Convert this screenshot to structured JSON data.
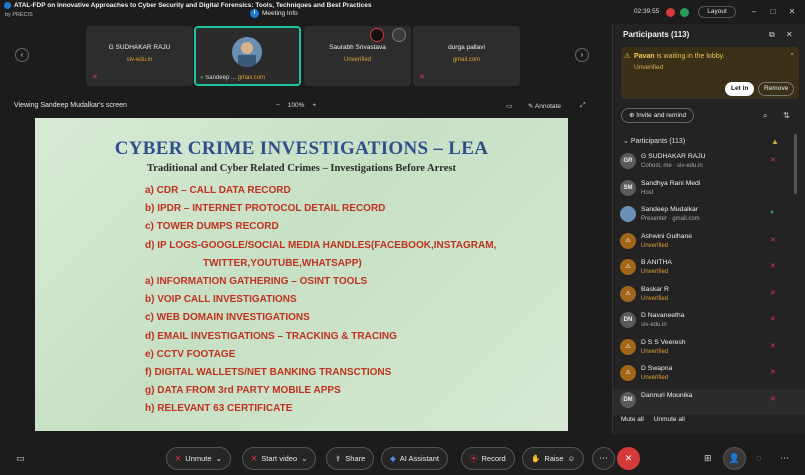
{
  "window": {
    "title": "ATAL-FDP on Innovative Approaches to Cyber Security and Digital Forensics: Tools, Techniques and Best Practices",
    "brand": "by PRECIS",
    "meeting_info": "Meeting Info",
    "clock": "02:39:55",
    "layout_label": "Layout"
  },
  "video_tiles": [
    {
      "name": "G SUDHAKAR RAJU",
      "sub": "siv-edu.in"
    },
    {
      "name": "Sandeep ...",
      "sub": "gmail.com"
    },
    {
      "name": "Saurabh Srivastava",
      "sub": "Unverified"
    },
    {
      "name": "durga pallavi",
      "sub": "gmail.com"
    }
  ],
  "share_bar": {
    "viewing": "Viewing Sandeep Mudalkar's screen",
    "zoom": "100%",
    "zoom_minus": "−",
    "zoom_plus": "+",
    "annotate": "Annotate"
  },
  "slide": {
    "title": "CYBER CRIME INVESTIGATIONS – LEA",
    "subtitle": "Traditional and Cyber Related Crimes – Investigations Before Arrest",
    "items": [
      "a)  CDR – CALL DATA RECORD",
      "b)  IPDR – INTERNET PROTOCOL DETAIL RECORD",
      "c)  TOWER DUMPS RECORD",
      "d)  IP LOGS-GOOGLE/SOCIAL MEDIA HANDLES(FACEBOOK,INSTAGRAM,",
      "TWITTER,YOUTUBE,WHATSAPP)",
      "a)  INFORMATION GATHERING – OSINT TOOLS",
      "b)  VOIP CALL INVESTIGATIONS",
      "c)  WEB DOMAIN INVESTIGATIONS",
      "d)  EMAIL INVESTIGATIONS – TRACKING & TRACING",
      "e)  CCTV FOOTAGE",
      "f)   DIGITAL WALLETS/NET BANKING TRANSCTIONS",
      "g)  DATA  FROM 3rd PARTY MOBILE APPS",
      "h)  RELEVANT 63 CERTIFICATE"
    ]
  },
  "toolbar": {
    "unmute": "Unmute",
    "start_video": "Start video",
    "share": "Share",
    "ai_assistant": "AI Assistant",
    "record": "Record",
    "raise": "Raise"
  },
  "panel": {
    "title": "Participants (113)",
    "lobby_name": "Pavan",
    "lobby_text": " is waiting in the lobby.",
    "lobby_sub": "Unverified",
    "let_in": "Let in",
    "remove": "Remove",
    "invite": "Invite and remind",
    "list_header": "Participants (113)",
    "participants": [
      {
        "initials": "GR",
        "name": "G SUDHAKAR RAJU",
        "sub": "Cohost, me · siv-edu.in",
        "unverified": false,
        "avatar": "gray"
      },
      {
        "initials": "SM",
        "name": "Sandhya Rani Medi",
        "sub": "Host",
        "unverified": false,
        "avatar": "gray"
      },
      {
        "initials": "",
        "name": "Sandeep Mudalkar",
        "sub": "Presenter · gmail.com",
        "unverified": false,
        "avatar": "photo"
      },
      {
        "initials": "",
        "name": "Ashwini Gulhane",
        "sub": "Unverified",
        "unverified": true,
        "avatar": "orange"
      },
      {
        "initials": "",
        "name": "B ANITHA",
        "sub": "Unverified",
        "unverified": true,
        "avatar": "orange"
      },
      {
        "initials": "",
        "name": "Baskar R",
        "sub": "Unverified",
        "unverified": true,
        "avatar": "orange"
      },
      {
        "initials": "DN",
        "name": "D Navaneetha",
        "sub": "siv-edu.in",
        "unverified": false,
        "avatar": "gray"
      },
      {
        "initials": "",
        "name": "D S S Veeresh",
        "sub": "Unverified",
        "unverified": true,
        "avatar": "orange"
      },
      {
        "initials": "",
        "name": "D Swapna",
        "sub": "Unverified",
        "unverified": true,
        "avatar": "orange"
      },
      {
        "initials": "DM",
        "name": "Dannuri  Mounika",
        "sub": "",
        "unverified": false,
        "avatar": "gray"
      }
    ],
    "mute_all": "Mute all",
    "unmute_all": "Unmute all"
  }
}
